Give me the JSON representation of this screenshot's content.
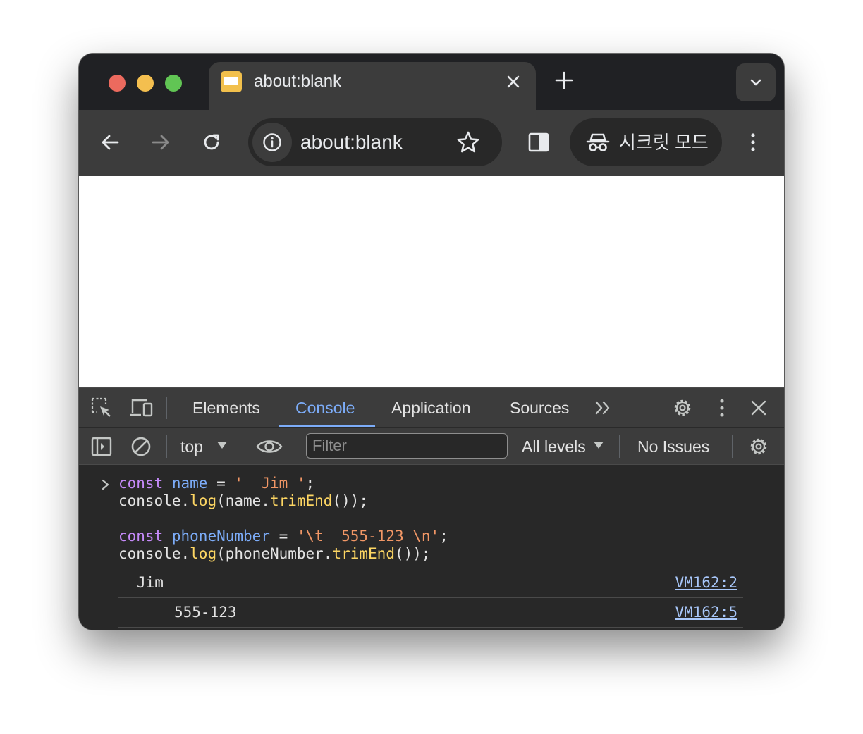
{
  "window": {
    "traffic_lights": {
      "close": "#ec6a5e",
      "minimize": "#f4bf4f",
      "zoom": "#61c554"
    }
  },
  "tab": {
    "title": "about:blank",
    "favicon_color": "#f2c04c"
  },
  "toolbar": {
    "omnibox_text": "about:blank",
    "incognito_label": "시크릿 모드"
  },
  "devtools": {
    "tabs": [
      "Elements",
      "Console",
      "Application",
      "Sources"
    ],
    "active_tab": "Console",
    "console_bar": {
      "context": "top",
      "filter_placeholder": "Filter",
      "levels": "All levels",
      "issues": "No Issues"
    },
    "console": {
      "input": {
        "l1": {
          "kw": "const",
          "name": "name",
          "eq": " = ",
          "str": "'  Jim '",
          "end": ";"
        },
        "l2": {
          "obj": "console.",
          "fn": "log",
          "mid": "(name.",
          "fn2": "trimEnd",
          "end": "());"
        },
        "l3": {
          "kw": "const",
          "name": "phoneNumber",
          "eq": " = ",
          "str": "'\\t  555-123 \\n'",
          "end": ";"
        },
        "l4": {
          "obj": "console.",
          "fn": "log",
          "mid": "(phoneNumber.",
          "fn2": "trimEnd",
          "end": "());"
        }
      },
      "outputs": [
        {
          "text": "Jim",
          "source": "VM162:2"
        },
        {
          "text": "555-123",
          "source": "VM162:5"
        }
      ]
    }
  }
}
